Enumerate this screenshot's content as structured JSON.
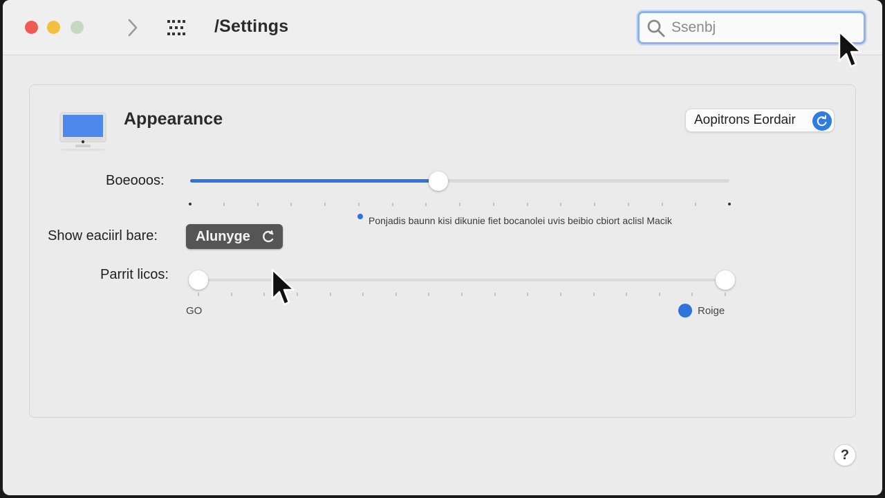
{
  "window": {
    "title": "/Settings"
  },
  "toolbar": {
    "forward_icon": "chevron-right-icon",
    "grid_icon": "grid-icon"
  },
  "search": {
    "placeholder": "Ssenbj"
  },
  "section": {
    "title": "Appearance",
    "icon": "monitor-icon",
    "options_button_label": "Aopitrons Eordair",
    "options_badge_icon": "refresh-icon"
  },
  "row1": {
    "label": "Boeooos:",
    "slider_value_fraction": 0.46,
    "hint": "Ponjadis baunn kisi dikunie fiet bocanolei uvis beibio cbiort aclisl Macik"
  },
  "row2": {
    "label": "Show eaciirl bare:",
    "popup_value": "Alunyge"
  },
  "row3": {
    "label": "Parrit licos:",
    "range_min_label": "GO",
    "range_max_label": "Roige",
    "low_fraction": 0.0,
    "high_fraction": 1.0
  },
  "help": {
    "label": "?"
  },
  "colors": {
    "accent": "#2f74dc",
    "window_bg": "#ececec",
    "search_focus": "#8fb2ee",
    "traffic_red": "#ee5b53",
    "traffic_yellow": "#f3bf3d",
    "traffic_green": "#c6d8c4"
  }
}
